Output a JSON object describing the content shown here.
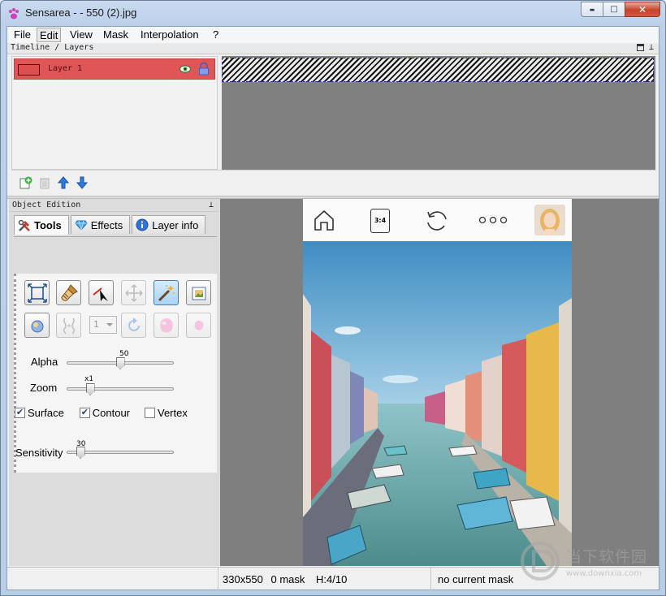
{
  "window": {
    "title": "Sensarea - - 550 (2).jpg",
    "controls": {
      "minimize": "▬",
      "maximize": "□",
      "close": "✕"
    }
  },
  "menu": [
    "File",
    "Edit",
    "View",
    "Mask",
    "Interpolation",
    "?"
  ],
  "menu_active": "Edit",
  "timeline_panel": {
    "title": "Timeline / Layers",
    "layers": [
      {
        "name": "Layer 1",
        "visible": true,
        "locked": true,
        "selected": true,
        "color": "#e05555"
      }
    ],
    "toolbar": [
      "add-layer-icon",
      "delete-layer-icon",
      "move-up-icon",
      "move-down-icon"
    ]
  },
  "object_panel": {
    "title": "Object Edition",
    "tabs": [
      {
        "label": "Tools",
        "icon": "tools-icon",
        "active": true
      },
      {
        "label": "Effects",
        "icon": "gem-icon",
        "active": false
      },
      {
        "label": "Layer info",
        "icon": "info-icon",
        "active": false
      }
    ],
    "tools_row1": [
      "fit-frame-icon",
      "brush-icon",
      "pen-icon",
      "move-icon",
      "magic-wand-icon",
      "image-icon"
    ],
    "tools_row2": [
      "ellipse-icon",
      "flip-icon",
      "rotate-icon",
      "blob-icon",
      "small-blob-icon"
    ],
    "step_select": "1",
    "alpha": {
      "label": "Alpha",
      "value": "50",
      "percent": 0.5
    },
    "zoom": {
      "label": "Zoom",
      "value": "x1",
      "percent": 0.22
    },
    "checks": [
      {
        "label": "Surface",
        "checked": true
      },
      {
        "label": "Contour",
        "checked": true
      },
      {
        "label": "Vertex",
        "checked": false
      }
    ],
    "sensitivity": {
      "label": "Sensitivity",
      "value": "30",
      "percent": 0.13
    }
  },
  "preview": {
    "header_label": "3:4",
    "header_icons": [
      "home-icon",
      "aspect-ratio-icon",
      "refresh-icon",
      "more-icon",
      "avatar"
    ]
  },
  "status": {
    "dimensions": "330x550",
    "mask_count": "0 mask",
    "h_position": "H:4/10",
    "mask_state": "no current mask"
  },
  "watermark": {
    "text": "当下软件园",
    "url": "www.downxia.com"
  }
}
